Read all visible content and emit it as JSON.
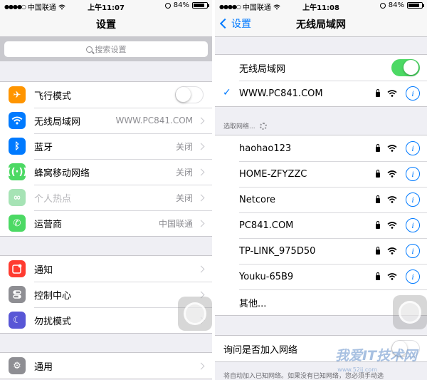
{
  "left": {
    "status": {
      "carrier": "中国联通",
      "time": "上午11:07",
      "battery": "84%"
    },
    "title": "设置",
    "search_placeholder": "搜索设置",
    "group1": [
      {
        "label": "飞行模式",
        "icon": "airplane-icon",
        "color": "#ff9500",
        "control": "toggle-off"
      },
      {
        "label": "无线局域网",
        "icon": "wifi-icon",
        "color": "#007aff",
        "value": "WWW.PC841.COM"
      },
      {
        "label": "蓝牙",
        "icon": "bluetooth-icon",
        "color": "#007aff",
        "value": "关闭"
      },
      {
        "label": "蜂窝移动网络",
        "icon": "cellular-icon",
        "color": "#4cd964",
        "value": "关闭"
      },
      {
        "label": "个人热点",
        "icon": "hotspot-icon",
        "color": "#a6e3b5",
        "value": "关闭",
        "disabled": true
      },
      {
        "label": "运营商",
        "icon": "phone-icon",
        "color": "#4cd964",
        "value": "中国联通"
      }
    ],
    "group2": [
      {
        "label": "通知",
        "icon": "notifications-icon",
        "color": "#ff3b30"
      },
      {
        "label": "控制中心",
        "icon": "control-center-icon",
        "color": "#8e8e93"
      },
      {
        "label": "勿扰模式",
        "icon": "moon-icon",
        "color": "#5856d6"
      }
    ],
    "group3": [
      {
        "label": "通用",
        "icon": "gear-icon",
        "color": "#8e8e93"
      }
    ]
  },
  "right": {
    "status": {
      "carrier": "中国联通",
      "time": "上午11:08",
      "battery": "84%"
    },
    "back_label": "设置",
    "title": "无线局域网",
    "wifi_label": "无线局域网",
    "wifi_on": true,
    "connected": "WWW.PC841.COM",
    "section_header": "选取网络...",
    "networks": [
      {
        "name": "haohao123",
        "locked": true
      },
      {
        "name": "HOME-ZFYZZC",
        "locked": true
      },
      {
        "name": "Netcore",
        "locked": true
      },
      {
        "name": "PC841.COM",
        "locked": true
      },
      {
        "name": "TP-LINK_975D50",
        "locked": true
      },
      {
        "name": "Youku-65B9",
        "locked": true
      }
    ],
    "other_label": "其他...",
    "ask_label": "询问是否加入网络",
    "footnote": "将自动加入已知网络。如果没有已知网络，您必须手动选",
    "watermark": "我爱IT技术网",
    "watermark_sub": "www.52ij.com"
  }
}
